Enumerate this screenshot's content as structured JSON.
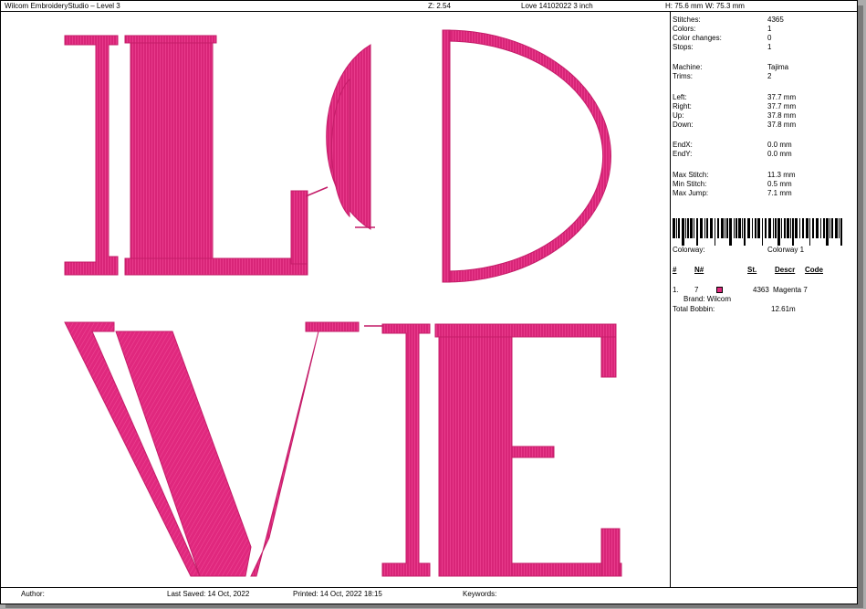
{
  "header": {
    "app_title": "Wilcom EmbroideryStudio – Level 3",
    "zoom": "Z: 2.54",
    "design_name": "Love 14102022 3 inch",
    "height": "H: 75.6 mm",
    "width": "W: 75.3 mm"
  },
  "info": {
    "stitches_label": "Stitches:",
    "stitches": "4365",
    "colors_label": "Colors:",
    "colors": "1",
    "color_changes_label": "Color changes:",
    "color_changes": "0",
    "stops_label": "Stops:",
    "stops": "1",
    "machine_label": "Machine:",
    "machine": "Tajima",
    "trims_label": "Trims:",
    "trims": "2",
    "left_label": "Left:",
    "left": "37.7 mm",
    "right_label": "Right:",
    "right": "37.7 mm",
    "up_label": "Up:",
    "up": "37.8 mm",
    "down_label": "Down:",
    "down": "37.8 mm",
    "endx_label": "EndX:",
    "endx": "0.0 mm",
    "endy_label": "EndY:",
    "endy": "0.0 mm",
    "max_stitch_label": "Max Stitch:",
    "max_stitch": "11.3 mm",
    "min_stitch_label": "Min Stitch:",
    "min_stitch": "0.5 mm",
    "max_jump_label": "Max Jump:",
    "max_jump": "7.1 mm",
    "colorway_label": "Colorway:",
    "colorway": "Colorway 1"
  },
  "color_table": {
    "headers": {
      "idx": "#",
      "needle": "N#",
      "stitches": "St.",
      "descr": "Descr",
      "code": "Code"
    },
    "rows": [
      {
        "idx": "1.",
        "needle": "7",
        "swatch": "#e0287e",
        "stitches": "4363",
        "descr": "Magenta 7",
        "brand": "Brand: Wilcom"
      }
    ],
    "total_bobbin_label": "Total Bobbin:",
    "total_bobbin": "12.61m"
  },
  "footer": {
    "author_label": "Author:",
    "last_saved": "Last Saved: 14 Oct, 2022",
    "printed": "Printed: 14 Oct, 2022 18:15",
    "keywords_label": "Keywords:"
  },
  "colors": {
    "thread": "#e0287e",
    "thread_dark": "#c41d69",
    "thread_light": "#f04b98"
  }
}
